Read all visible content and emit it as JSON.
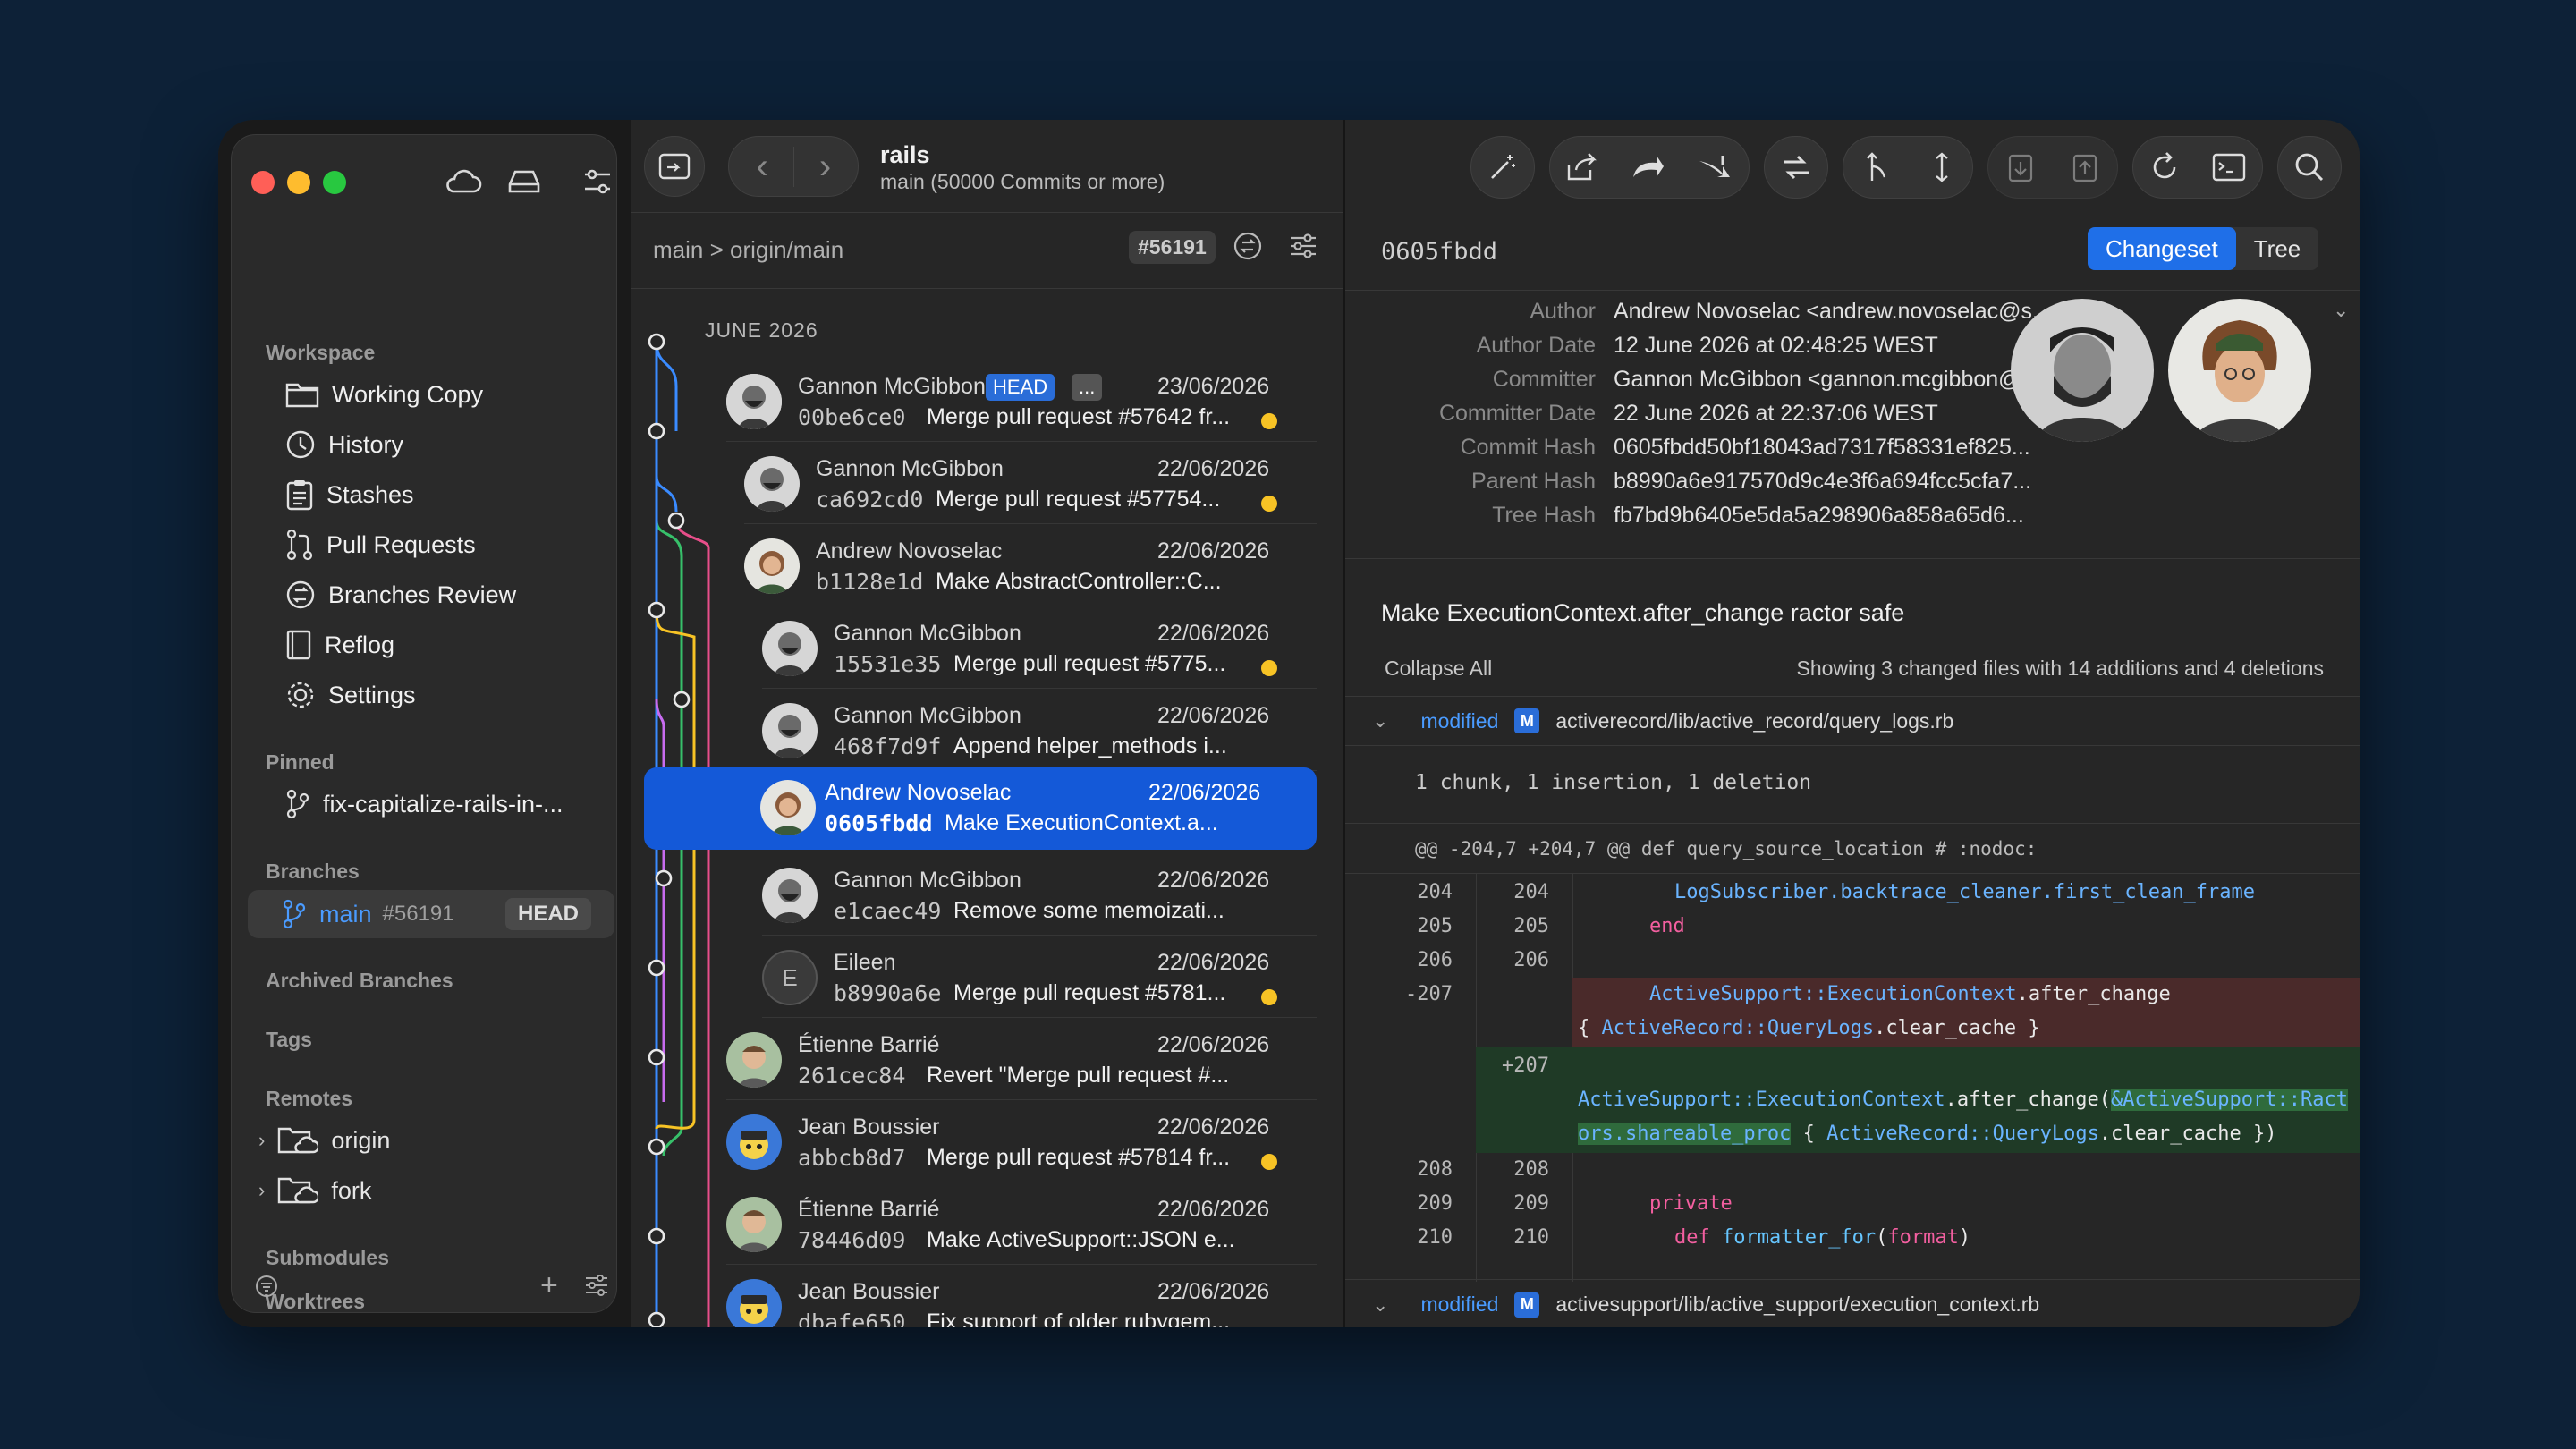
{
  "repo": {
    "name": "rails",
    "subtitle": "main (50000 Commits or more)"
  },
  "sidebar": {
    "workspace_label": "Workspace",
    "workspace_items": [
      {
        "label": "Working Copy",
        "icon": "folder-icon"
      },
      {
        "label": "History",
        "icon": "history-icon"
      },
      {
        "label": "Stashes",
        "icon": "clipboard-icon"
      },
      {
        "label": "Pull Requests",
        "icon": "pull-request-icon"
      },
      {
        "label": "Branches Review",
        "icon": "branches-review-icon"
      },
      {
        "label": "Reflog",
        "icon": "book-icon"
      },
      {
        "label": "Settings",
        "icon": "gear-icon"
      }
    ],
    "pinned_label": "Pinned",
    "pinned_item": "fix-capitalize-rails-in-...",
    "branches_label": "Branches",
    "branch": {
      "name": "main",
      "number": "#56191",
      "badge": "HEAD"
    },
    "archived_label": "Archived Branches",
    "tags_label": "Tags",
    "remotes_label": "Remotes",
    "remotes": [
      "origin",
      "fork"
    ],
    "submodules_label": "Submodules",
    "worktrees_label": "Worktrees"
  },
  "history": {
    "branch_path": "main > origin/main",
    "commit_badge": "#56191",
    "month_label": "JUNE 2026",
    "head_tag": "HEAD",
    "more_tag": "...",
    "commits": [
      {
        "author": "Gannon McGibbon",
        "date": "23/06/2026",
        "hash": "00be6ce0",
        "message": "Merge pull request #57642 fr...",
        "dot": true
      },
      {
        "author": "Gannon McGibbon",
        "date": "22/06/2026",
        "hash": "ca692cd0",
        "message": "Merge pull request #57754...",
        "dot": true
      },
      {
        "author": "Andrew Novoselac",
        "date": "22/06/2026",
        "hash": "b1128e1d",
        "message": "Make AbstractController::C...",
        "dot": false
      },
      {
        "author": "Gannon McGibbon",
        "date": "22/06/2026",
        "hash": "15531e35",
        "message": "Merge pull request #5775...",
        "dot": true
      },
      {
        "author": "Gannon McGibbon",
        "date": "22/06/2026",
        "hash": "468f7d9f",
        "message": "Append helper_methods i...",
        "dot": false
      },
      {
        "author": "Andrew Novoselac",
        "date": "22/06/2026",
        "hash": "0605fbdd",
        "message": "Make ExecutionContext.a...",
        "dot": false
      },
      {
        "author": "Gannon McGibbon",
        "date": "22/06/2026",
        "hash": "e1caec49",
        "message": "Remove some memoizati...",
        "dot": false
      },
      {
        "author": "Eileen",
        "date": "22/06/2026",
        "hash": "b8990a6e",
        "message": "Merge pull request #5781...",
        "dot": true,
        "initial": "E"
      },
      {
        "author": "Étienne Barrié",
        "date": "22/06/2026",
        "hash": "261cec84",
        "message": "Revert \"Merge pull request #...",
        "dot": false
      },
      {
        "author": "Jean Boussier",
        "date": "22/06/2026",
        "hash": "abbcb8d7",
        "message": "Merge pull request #57814 fr...",
        "dot": true
      },
      {
        "author": "Étienne Barrié",
        "date": "22/06/2026",
        "hash": "78446d09",
        "message": "Make ActiveSupport::JSON e...",
        "dot": false
      },
      {
        "author": "Jean Boussier",
        "date": "22/06/2026",
        "hash": "dbafe650",
        "message": "Fix support of older rubygem...",
        "dot": false
      }
    ]
  },
  "detail": {
    "commit_id": "0605fbdd",
    "tabs": {
      "changeset": "Changeset",
      "tree": "Tree"
    },
    "meta": [
      {
        "key": "Author",
        "value": "Andrew Novoselac <andrew.novoselac@s..."
      },
      {
        "key": "Author Date",
        "value": "12 June 2026 at 02:48:25 WEST"
      },
      {
        "key": "Committer",
        "value": "Gannon McGibbon <gannon.mcgibbon@g..."
      },
      {
        "key": "Committer Date",
        "value": "22 June 2026 at 22:37:06 WEST"
      },
      {
        "key": "Commit Hash",
        "value": "0605fbdd50bf18043ad7317f58331ef825..."
      },
      {
        "key": "Parent Hash",
        "value": "b8990a6e917570d9c4e3f6a694fcc5cfa7..."
      },
      {
        "key": "Tree Hash",
        "value": "fb7bd9b6405e5da5a298906a858a65d6..."
      }
    ],
    "subject": "Make ExecutionContext.after_change ractor safe",
    "collapse_all": "Collapse All",
    "summary": "Showing 3 changed files with 14 additions and 4 deletions",
    "files": [
      {
        "status": "modified",
        "badge": "M",
        "path": "activerecord/lib/active_record/query_logs.rb"
      },
      {
        "status": "modified",
        "badge": "M",
        "path": "activesupport/lib/active_support/execution_context.rb"
      }
    ],
    "chunk_info": "1 chunk, 1 insertion, 1 deletion",
    "hunk_header": "@@ -204,7 +204,7 @@ def query_source_location # :nodoc:",
    "diff_lines": {
      "l204": {
        "old": "204",
        "new": "204",
        "code": "LogSubscriber.backtrace_cleaner.first_clean_frame"
      },
      "l205": {
        "old": "205",
        "new": "205",
        "code": "end"
      },
      "l206": {
        "old": "206",
        "new": "206",
        "code": ""
      },
      "del": {
        "old": "-207",
        "a": "ActiveSupport::ExecutionContext",
        "b": ".after_change",
        "c": "{ ",
        "d": "ActiveRecord::QueryLogs",
        "e": ".clear_cache }"
      },
      "add": {
        "new": "+207",
        "a": "ActiveSupport::ExecutionContext",
        "b": ".after_change(",
        "c": "&ActiveSupport::Ract",
        "d": "ors.shareable_proc",
        "e": " { ",
        "f": "ActiveRecord::QueryLogs",
        "g": ".clear_cache })"
      },
      "l208": {
        "old": "208",
        "new": "208",
        "code": ""
      },
      "l209": {
        "old": "209",
        "new": "209",
        "code": "private"
      },
      "l210": {
        "old": "210",
        "new": "210",
        "code1": "def ",
        "code2": "formatter_for",
        "code3": "(",
        "code4": "format",
        "code5": ")"
      }
    }
  },
  "colors": {
    "accent": "#1459d8",
    "traffic_red": "#ff5f57",
    "traffic_yellow": "#febc2e",
    "traffic_green": "#28c840",
    "warning_dot": "#f7c325"
  }
}
